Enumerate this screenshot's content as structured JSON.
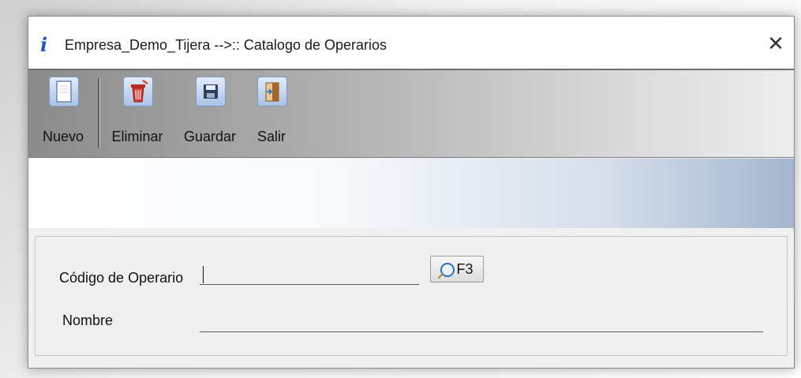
{
  "window": {
    "title": "Empresa_Demo_Tijera -->:: Catalogo de Operarios",
    "close_symbol": "✕"
  },
  "toolbar": {
    "buttons": [
      {
        "label": "Nuevo",
        "icon": "new-document-icon"
      },
      {
        "label": "Eliminar",
        "icon": "trash-icon"
      },
      {
        "label": "Guardar",
        "icon": "save-disk-icon"
      },
      {
        "label": "Salir",
        "icon": "exit-door-icon"
      }
    ]
  },
  "form": {
    "codigo_label": "Código de Operario",
    "codigo_value": "",
    "search_button_label": "F3",
    "nombre_label": "Nombre",
    "nombre_value": ""
  },
  "colors": {
    "accent_blue": "#1a5bbd",
    "toolbar_dark": "#8b8b8b",
    "banner_blue": "#a3b6ce"
  }
}
